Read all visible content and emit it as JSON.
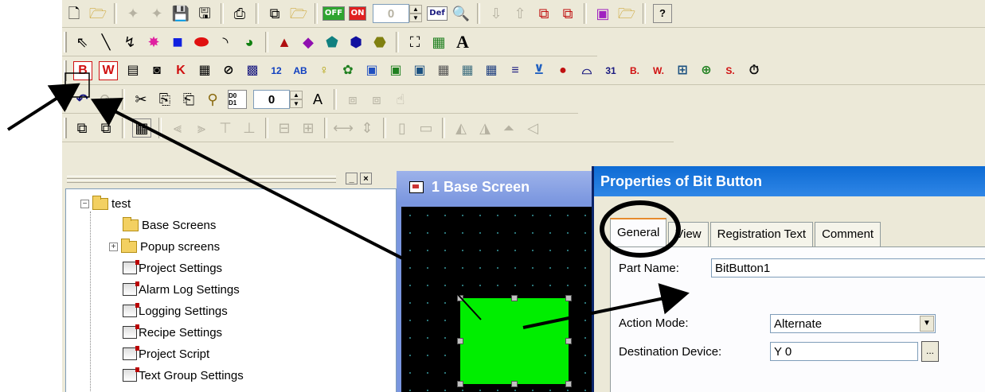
{
  "toolbar1": {
    "icons": [
      "new-file-icon",
      "open-folder-icon",
      "cut-part-icon",
      "copy-part-icon",
      "save-icon",
      "save-all-icon",
      "print-icon",
      "transfer-icon",
      "open-icon",
      "off-state-icon",
      "on-state-icon",
      "default-icon",
      "preview-icon",
      "download-icon",
      "upload-icon",
      "import-icon",
      "export-icon",
      "library-icon",
      "open-library-icon",
      "help-icon"
    ],
    "off_label": "OFF",
    "on_label": "ON",
    "state_value": "0",
    "def_label": "Def"
  },
  "toolbar2": {
    "icons": [
      "select-arrow-icon",
      "line-icon",
      "polyline-icon",
      "star-icon",
      "rectangle-icon",
      "ellipse-icon",
      "arc-icon",
      "pie-icon",
      "triangle-icon",
      "diamond-icon",
      "pentagon-icon",
      "hexagon-icon",
      "octagon-icon",
      "fill-icon",
      "picture-icon",
      "text-icon"
    ],
    "text_glyph": "A"
  },
  "toolbar3": {
    "buttons": [
      {
        "label": "B",
        "color": "#d01010",
        "name": "bit-button-tool"
      },
      {
        "label": "W",
        "color": "#d01010",
        "name": "word-button-tool"
      },
      {
        "label": "▤",
        "color": "#000000",
        "name": "screen-change-button-tool"
      },
      {
        "label": "◙",
        "color": "#000000",
        "name": "function-button-tool"
      },
      {
        "label": "K",
        "color": "#d01010",
        "name": "keypad-tool"
      },
      {
        "label": "▦",
        "color": "#000000",
        "name": "table-tool"
      },
      {
        "label": "⊘",
        "color": "#000000",
        "name": "selector-switch-tool"
      },
      {
        "label": "▩",
        "color": "#1a1a80",
        "name": "multistate-tool"
      },
      {
        "label": "12",
        "color": "#1040c0",
        "name": "numeric-display-tool"
      },
      {
        "label": "AB",
        "color": "#1040c0",
        "name": "string-display-tool"
      },
      {
        "label": "♀",
        "color": "#b0a000",
        "name": "lamp-tool"
      },
      {
        "label": "✿",
        "color": "#208020",
        "name": "animation-tool"
      },
      {
        "label": "▣",
        "color": "#2050c0",
        "name": "picture-display-tool"
      },
      {
        "label": "▣",
        "color": "#208020",
        "name": "message-display-tool"
      },
      {
        "label": "▣",
        "color": "#1a5080",
        "name": "window-display-tool"
      },
      {
        "label": "▦",
        "color": "#555555",
        "name": "alarm-display-tool"
      },
      {
        "label": "▦",
        "color": "#407080",
        "name": "alarm-history-tool"
      },
      {
        "label": "▦",
        "color": "#204080",
        "name": "data-table-tool"
      },
      {
        "label": "≡",
        "color": "#1a1a80",
        "name": "bar-graph-tool"
      },
      {
        "label": "⊻",
        "color": "#2060c0",
        "name": "trend-graph-tool"
      },
      {
        "label": "●",
        "color": "#c01010",
        "name": "pie-graph-tool"
      },
      {
        "label": "⌓",
        "color": "#1a1a80",
        "name": "meter-tool"
      },
      {
        "label": "31",
        "color": "#1a1a80",
        "name": "calendar-tool"
      },
      {
        "label": "B.",
        "color": "#d01010",
        "name": "bit-switch-tool"
      },
      {
        "label": "W.",
        "color": "#d01010",
        "name": "word-switch-tool"
      },
      {
        "label": "⊞",
        "color": "#1a5080",
        "name": "screen-switch-tool"
      },
      {
        "label": "⊕",
        "color": "#208020",
        "name": "function-switch-tool"
      },
      {
        "label": "S.",
        "color": "#d01010",
        "name": "string-switch-tool"
      },
      {
        "label": "⏱",
        "color": "#000000",
        "name": "timer-tool"
      }
    ]
  },
  "toolbar4": {
    "undo_glyph": "↶",
    "redo_glyph": "↷",
    "cut_glyph": "✂",
    "copy_glyph": "⎘",
    "paste_glyph": "⎗",
    "find_glyph": "ꔮ",
    "device_label": "D0 D1",
    "spin_value": "0",
    "font_glyph": "A"
  },
  "toolbar5": {
    "icons": [
      "bring-front-icon",
      "send-back-icon",
      "grid-icon",
      "align-left-icon",
      "align-right-icon",
      "align-top-icon",
      "align-bottom-icon",
      "center-horizontal-icon",
      "center-vertical-icon",
      "same-width-icon",
      "same-height-icon",
      "same-size-icon",
      "space-horizontal-icon",
      "space-vertical-icon",
      "flip-icon",
      "rotate-icon"
    ]
  },
  "tree": {
    "root": "test",
    "items": [
      {
        "label": "Base Screens",
        "icon": "folder-icon",
        "expander": ""
      },
      {
        "label": "Popup screens",
        "icon": "folder-icon",
        "expander": "+"
      },
      {
        "label": "Project Settings",
        "icon": "settings-icon",
        "expander": ""
      },
      {
        "label": "Alarm Log Settings",
        "icon": "settings-icon",
        "expander": ""
      },
      {
        "label": "Logging Settings",
        "icon": "settings-icon",
        "expander": ""
      },
      {
        "label": "Recipe Settings",
        "icon": "settings-icon",
        "expander": ""
      },
      {
        "label": "Project Script",
        "icon": "settings-icon",
        "expander": ""
      },
      {
        "label": "Text Group Settings",
        "icon": "settings-icon",
        "expander": ""
      }
    ],
    "minimize_glyph": "_",
    "close_glyph": "×"
  },
  "base_screen": {
    "title": "1  Base Screen",
    "button_color": "#00ee00"
  },
  "properties": {
    "title": "Properties of Bit Button",
    "tabs": [
      "General",
      "View",
      "Registration Text",
      "Comment"
    ],
    "active_tab": "General",
    "part_name_label": "Part Name:",
    "part_name_value": "BitButton1",
    "action_mode_label": "Action Mode:",
    "action_mode_value": "Alternate",
    "destination_label": "Destination Device:",
    "destination_value": "Y 0",
    "browse_label": "..."
  },
  "colors": {
    "app_bg": "#ece9d8",
    "title_blue": "#0d6bd4",
    "accent_green": "#00ee00",
    "annotation": "#000000"
  }
}
